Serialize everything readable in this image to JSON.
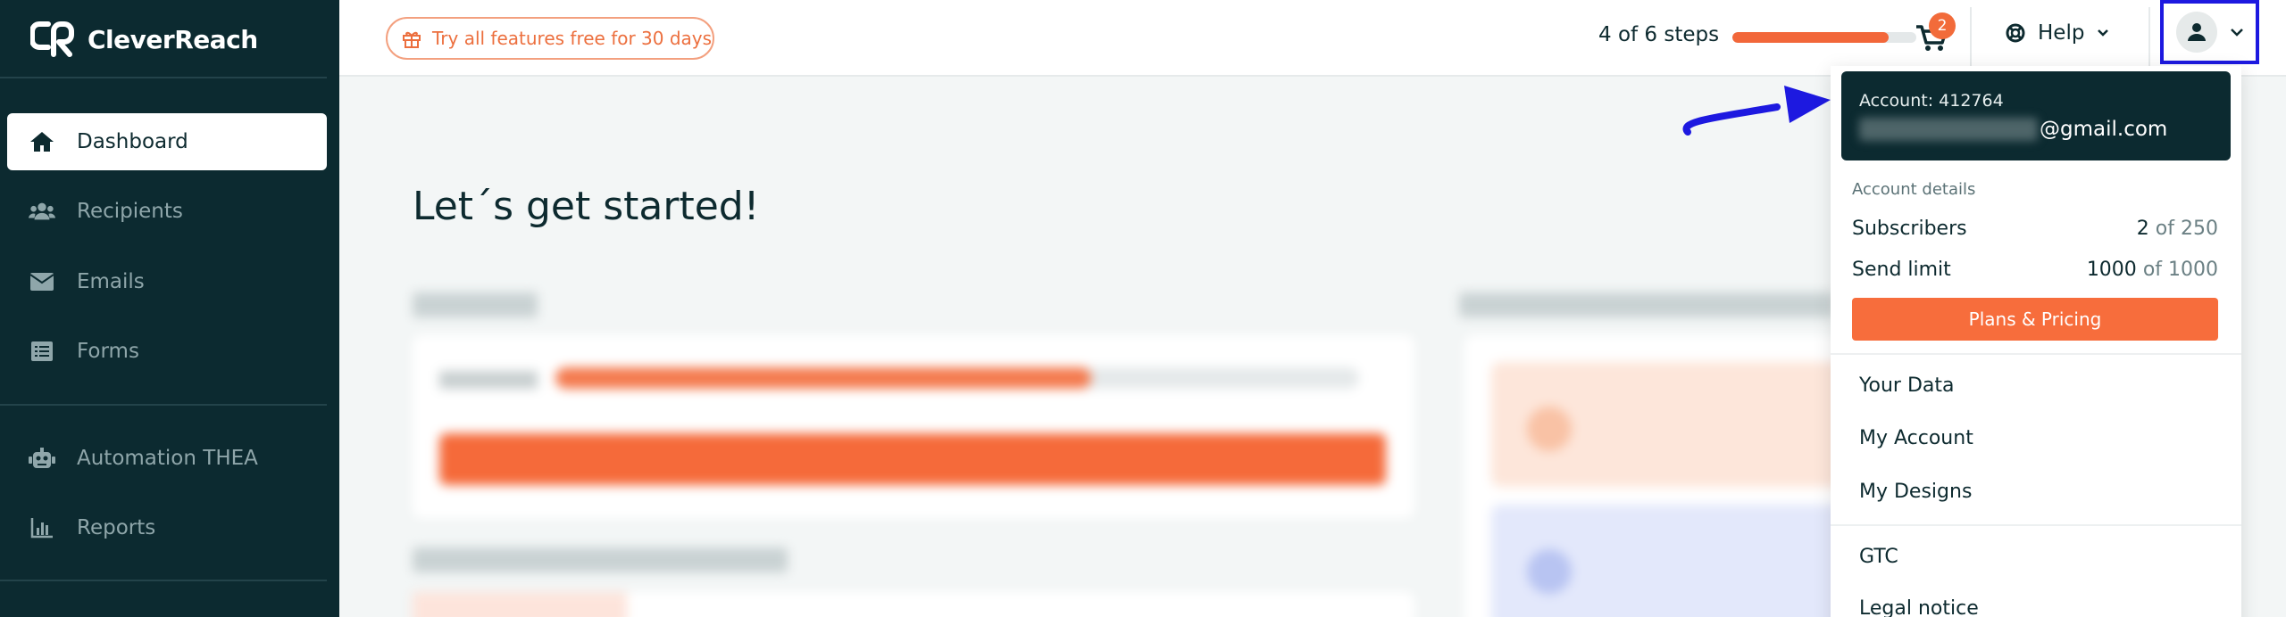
{
  "brand": {
    "name": "CleverReach"
  },
  "sidebar": {
    "items": [
      {
        "label": "Dashboard",
        "icon": "home-icon",
        "active": true
      },
      {
        "label": "Recipients",
        "icon": "users-icon",
        "active": false
      },
      {
        "label": "Emails",
        "icon": "envelope-icon",
        "active": false
      },
      {
        "label": "Forms",
        "icon": "list-icon",
        "active": false
      },
      {
        "label": "Automation THEA",
        "icon": "robot-icon",
        "active": false
      },
      {
        "label": "Reports",
        "icon": "bar-chart-icon",
        "active": false
      }
    ]
  },
  "topbar": {
    "trial_label": "Try all features free for 30 days",
    "steps_label": "4 of 6 steps",
    "steps_progress": 0.85,
    "cart_badge": "2",
    "help_label": "Help"
  },
  "main": {
    "title": "Let´s get started!"
  },
  "account_menu": {
    "account_label": "Account: 412764",
    "email_suffix": "@gmail.com",
    "details_label": "Account details",
    "subscribers_label": "Subscribers",
    "subscribers_value": "2",
    "subscribers_total": "of 250",
    "send_limit_label": "Send limit",
    "send_limit_value": "1000",
    "send_limit_total": "of 1000",
    "plans_button": "Plans & Pricing",
    "links": [
      "Your Data",
      "My Account",
      "My Designs"
    ],
    "legal_links": [
      "GTC",
      "Legal notice"
    ]
  },
  "colors": {
    "sidebar_bg": "#0c2a30",
    "accent": "#f76d3c",
    "highlight_box": "#1d19e0"
  }
}
